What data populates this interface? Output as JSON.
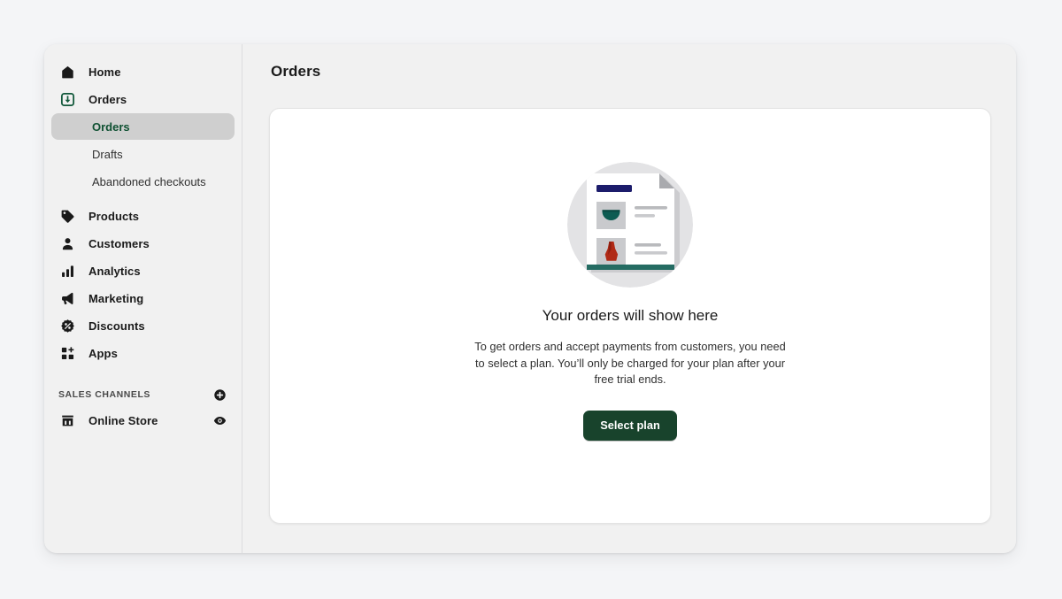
{
  "window": {
    "sidebar": {
      "nav": [
        {
          "label": "Home",
          "icon": "home-icon",
          "type": "item"
        },
        {
          "label": "Orders",
          "icon": "orders-icon",
          "type": "item"
        },
        {
          "label": "Orders",
          "type": "sub",
          "selected": true
        },
        {
          "label": "Drafts",
          "type": "sub",
          "selected": false
        },
        {
          "label": "Abandoned checkouts",
          "type": "sub",
          "selected": false
        },
        {
          "label": "Products",
          "icon": "tag-icon",
          "type": "item"
        },
        {
          "label": "Customers",
          "icon": "person-icon",
          "type": "item"
        },
        {
          "label": "Analytics",
          "icon": "bar-chart-icon",
          "type": "item"
        },
        {
          "label": "Marketing",
          "icon": "megaphone-icon",
          "type": "item"
        },
        {
          "label": "Discounts",
          "icon": "discount-icon",
          "type": "item"
        },
        {
          "label": "Apps",
          "icon": "apps-icon",
          "type": "item"
        }
      ],
      "sales_channels": {
        "heading": "SALES CHANNELS",
        "add_icon": "plus-circle-icon",
        "channels": [
          {
            "label": "Online Store",
            "icon": "storefront-icon",
            "action_icon": "eye-icon"
          }
        ]
      }
    },
    "main": {
      "page_title": "Orders",
      "empty_state": {
        "illustration": "orders-empty-illustration",
        "title": "Your orders will show here",
        "body": "To get orders and accept payments from customers, you need to select a plan. You’ll only be charged for your plan after your free trial ends.",
        "cta_label": "Select plan"
      }
    }
  },
  "colors": {
    "page_background": "#f4f5f7",
    "window_background": "#f1f1f1",
    "card_background": "#ffffff",
    "selected_nav_background": "#cfcfcf",
    "selected_nav_text": "#0f5132",
    "cta_background": "#18432c",
    "illustration_teal": "#0d5c52",
    "illustration_navy": "#1c1c6b",
    "illustration_red": "#b02a16"
  }
}
